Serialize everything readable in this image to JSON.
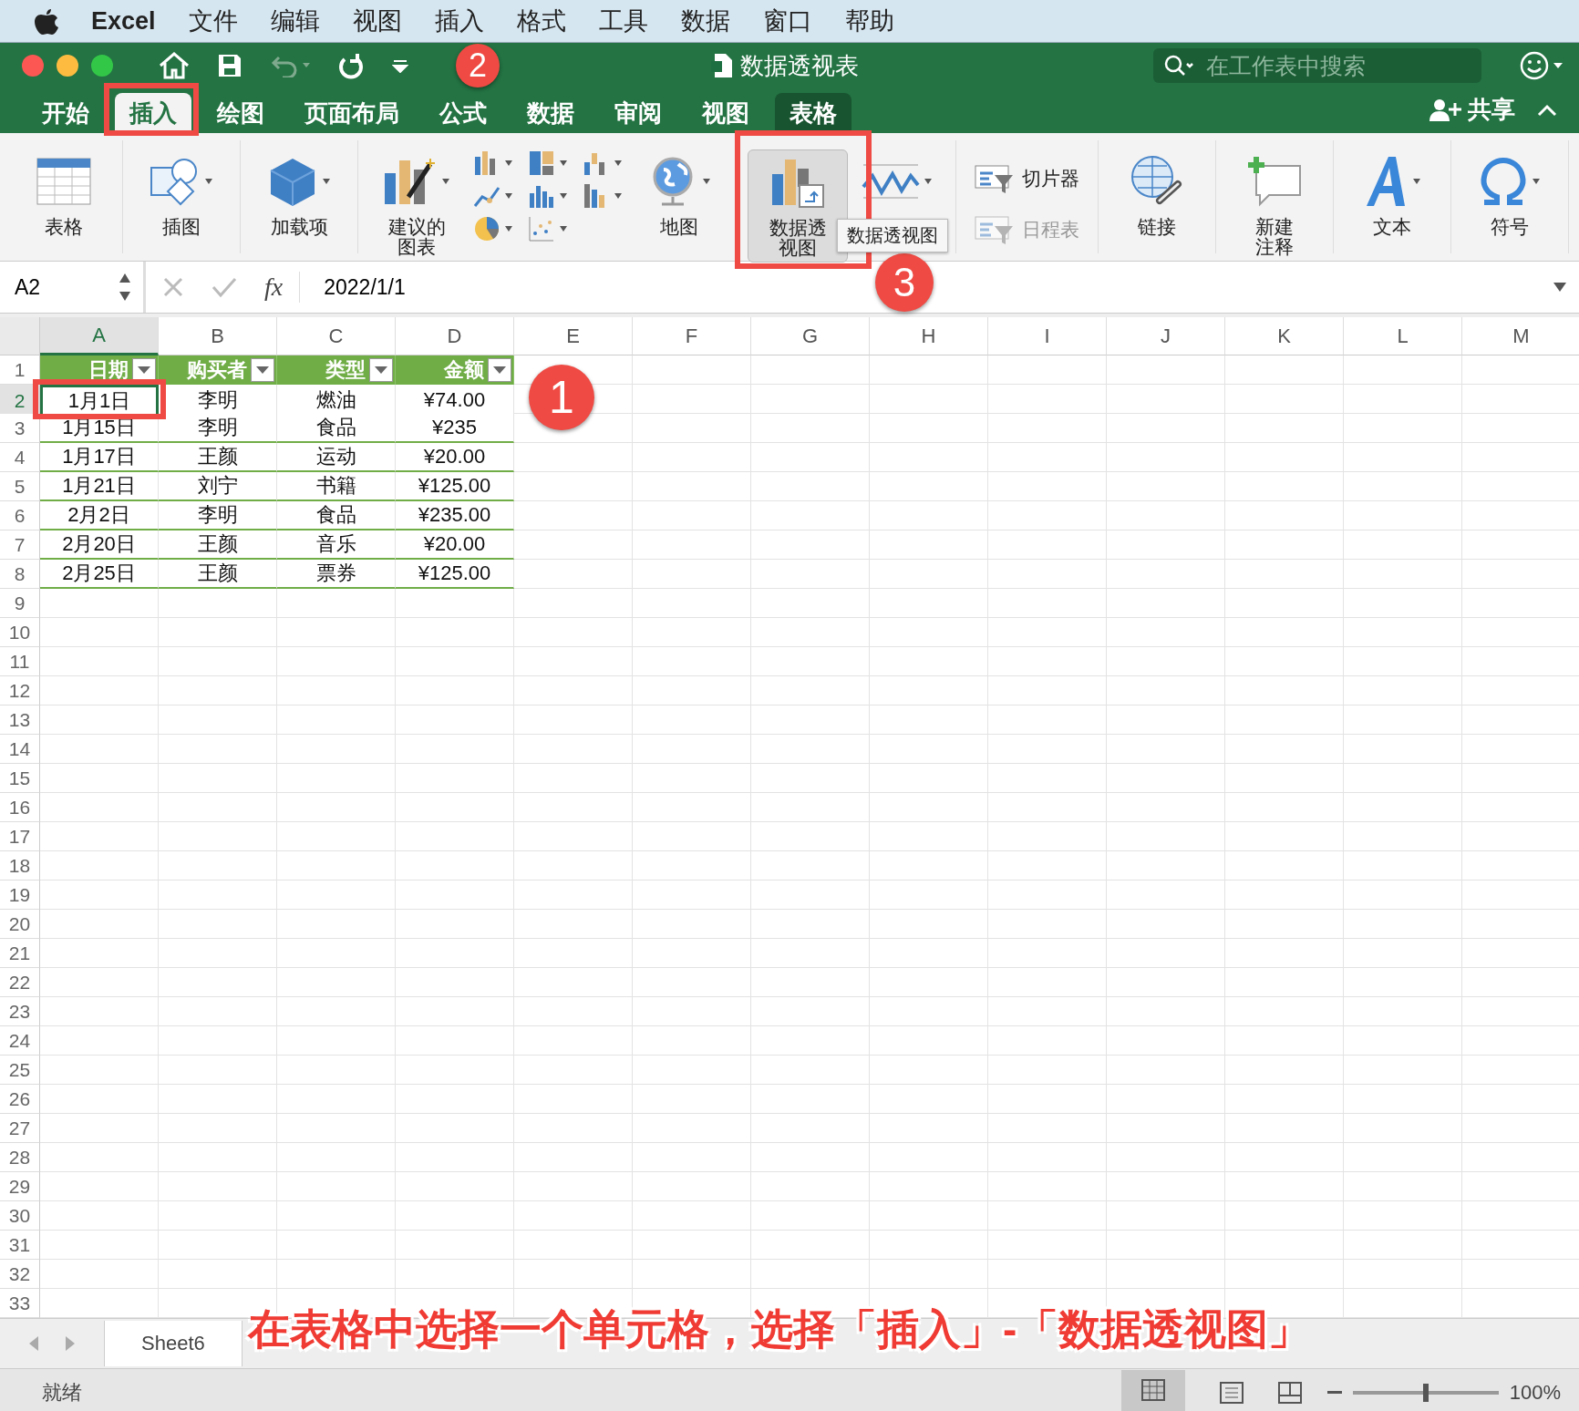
{
  "menu_bar": {
    "app": "Excel",
    "items": [
      "文件",
      "编辑",
      "视图",
      "插入",
      "格式",
      "工具",
      "数据",
      "窗口",
      "帮助"
    ]
  },
  "title_bar": {
    "title": "数据透视表",
    "search": {
      "placeholder": "在工作表中搜索"
    }
  },
  "tabs": [
    {
      "label": "开始",
      "selected": false,
      "contextual": false
    },
    {
      "label": "插入",
      "selected": true,
      "contextual": false
    },
    {
      "label": "绘图",
      "selected": false,
      "contextual": false
    },
    {
      "label": "页面布局",
      "selected": false,
      "contextual": false
    },
    {
      "label": "公式",
      "selected": false,
      "contextual": false
    },
    {
      "label": "数据",
      "selected": false,
      "contextual": false
    },
    {
      "label": "审阅",
      "selected": false,
      "contextual": false
    },
    {
      "label": "视图",
      "selected": false,
      "contextual": false
    },
    {
      "label": "表格",
      "selected": false,
      "contextual": true
    }
  ],
  "share": "共享",
  "ribbon": [
    {
      "kind": "large",
      "label": "表格",
      "dropdown": false,
      "highlighted": false
    },
    {
      "kind": "large",
      "label": "插图",
      "dropdown": true,
      "highlighted": false
    },
    {
      "kind": "large",
      "label": "加载项",
      "dropdown": true,
      "highlighted": false
    },
    {
      "kind": "large",
      "label": "建议的图表",
      "dropdown": true,
      "highlighted": false
    },
    {
      "kind": "gallery"
    },
    {
      "kind": "gallery"
    },
    {
      "kind": "gallery"
    },
    {
      "kind": "large",
      "label": "地图",
      "dropdown": true,
      "highlighted": false
    },
    {
      "kind": "large",
      "label": "数据透视图",
      "dropdown": false,
      "highlighted": true
    },
    {
      "kind": "large",
      "dropdown": true,
      "highlighted": false
    },
    {
      "kind": "pair",
      "items": [
        {
          "label": "切片器",
          "disabled": false
        },
        {
          "label": "日程表",
          "disabled": true
        }
      ]
    },
    {
      "kind": "large",
      "label": "链接",
      "dropdown": false,
      "highlighted": false
    },
    {
      "kind": "large",
      "label": "新建注释",
      "dropdown": false,
      "highlighted": false
    },
    {
      "kind": "large",
      "label": "文本",
      "dropdown": true,
      "highlighted": false
    },
    {
      "kind": "large",
      "label": "符号",
      "dropdown": true,
      "highlighted": false
    }
  ],
  "tooltip": "数据透视图",
  "formula_bar": {
    "name_box": "A2",
    "function_label": "fx",
    "formula": "2022/1/1"
  },
  "sheet": {
    "columns": [
      "A",
      "B",
      "C",
      "D",
      "E",
      "F",
      "G",
      "H",
      "I",
      "J",
      "K",
      "L",
      "M"
    ],
    "rows": [
      "1",
      "2",
      "3",
      "4",
      "5",
      "6",
      "7",
      "8",
      "9",
      "10",
      "11",
      "12",
      "13",
      "14",
      "15",
      "16",
      "17",
      "18",
      "19",
      "20",
      "21",
      "22",
      "23",
      "24",
      "25",
      "26",
      "27",
      "28",
      "29",
      "30",
      "31",
      "32",
      "33"
    ],
    "table": {
      "headers": [
        "日期",
        "购买者",
        "类型",
        "金额"
      ],
      "rows": [
        [
          {
            "text": "1月1日",
            "selected": true
          },
          {
            "text": "李明",
            "selected": false
          },
          {
            "text": "燃油",
            "selected": false
          },
          {
            "text": "¥74.00",
            "selected": false
          }
        ],
        [
          {
            "text": "1月15日",
            "selected": false
          },
          {
            "text": "李明",
            "selected": false
          },
          {
            "text": "食品",
            "selected": false
          },
          {
            "text": "¥235",
            "selected": false
          }
        ],
        [
          {
            "text": "1月17日",
            "selected": false
          },
          {
            "text": "王颜",
            "selected": false
          },
          {
            "text": "运动",
            "selected": false
          },
          {
            "text": "¥20.00",
            "selected": false
          }
        ],
        [
          {
            "text": "1月21日",
            "selected": false
          },
          {
            "text": "刘宁",
            "selected": false
          },
          {
            "text": "书籍",
            "selected": false
          },
          {
            "text": "¥125.00",
            "selected": false
          }
        ],
        [
          {
            "text": "2月2日",
            "selected": false
          },
          {
            "text": "李明",
            "selected": false
          },
          {
            "text": "食品",
            "selected": false
          },
          {
            "text": "¥235.00",
            "selected": false
          }
        ],
        [
          {
            "text": "2月20日",
            "selected": false
          },
          {
            "text": "王颜",
            "selected": false
          },
          {
            "text": "音乐",
            "selected": false
          },
          {
            "text": "¥20.00",
            "selected": false
          }
        ],
        [
          {
            "text": "2月25日",
            "selected": false
          },
          {
            "text": "王颜",
            "selected": false
          },
          {
            "text": "票券",
            "selected": false
          },
          {
            "text": "¥125.00",
            "selected": false
          }
        ]
      ]
    }
  },
  "sheet_tabs": [
    {
      "label": "Sheet6",
      "selected": true
    }
  ],
  "status_bar": {
    "status": "就绪",
    "zoom": {
      "level": 0.5,
      "reading": "100%"
    }
  },
  "annotations": {
    "callouts": [
      "1",
      "2",
      "3"
    ],
    "caption": "在表格中选择一个单元格，选择「插入」-「数据透视图」"
  }
}
